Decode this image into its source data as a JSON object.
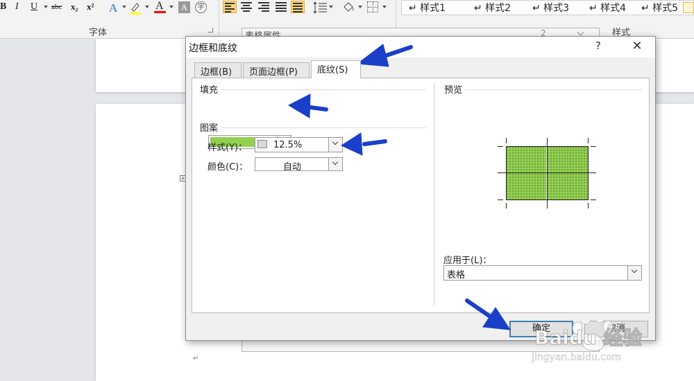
{
  "ribbon": {
    "font_buttons": [
      "B",
      "I",
      "U",
      "abc",
      "x₂",
      "x²",
      "A",
      "A"
    ],
    "font_group_label": "字体",
    "styles_group_label": "样式",
    "style_items": [
      "↵ 样式1",
      "↵ 样式2",
      "↵ 样式3",
      "↵ 样式4",
      "↵ 样式5"
    ],
    "accent_highlight": "#ffff00",
    "accent_font_color": "#ff0000"
  },
  "background_dialog": {
    "title": "表格属性",
    "page_num": "2",
    "buttons": [
      "确定",
      "取消"
    ]
  },
  "dialog": {
    "title": "边框和底纹",
    "help": "?",
    "close": "✕",
    "tabs": [
      {
        "label": "边框(B)"
      },
      {
        "label": "页面边框(P)"
      },
      {
        "label": "底纹(S)"
      }
    ],
    "fill": {
      "label": "填充",
      "color": "#92d050"
    },
    "pattern": {
      "label": "图案",
      "style_label": "样式(Y)：",
      "style_value": "12.5%",
      "color_label": "颜色(C)：",
      "color_value": "自动"
    },
    "preview_label": "预览",
    "apply_to": {
      "label": "应用于(L)：",
      "value": "表格"
    },
    "buttons": {
      "ok": "确定",
      "cancel": "取消"
    }
  },
  "watermark": {
    "brand": "Baidu 经验",
    "url": "jingyan.baidu.com"
  }
}
